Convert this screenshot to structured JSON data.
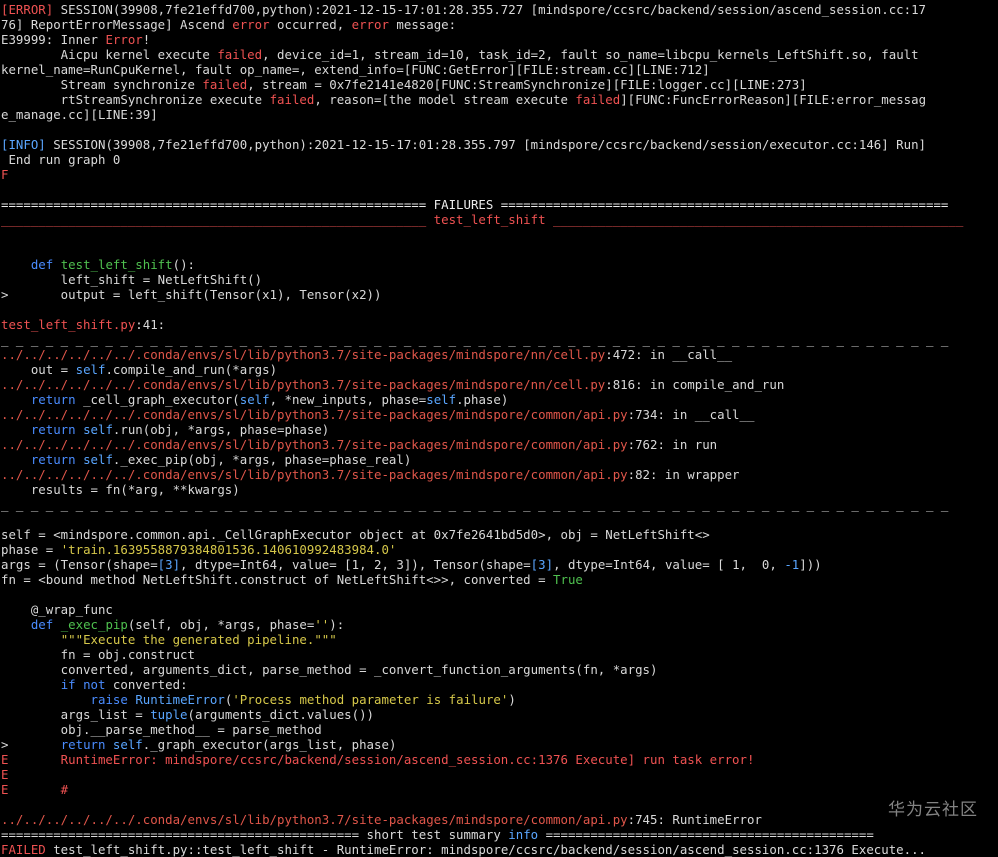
{
  "terminal": {
    "lines": [
      {
        "segs": [
          {
            "t": "[ERROR]",
            "c": "red"
          },
          {
            "t": " SESSION(39908,7fe21effd700,python):2021-12-15-17:01:28.355.727 [mindspore/ccsrc/backend/session/ascend_session.cc:17"
          }
        ]
      },
      {
        "segs": [
          {
            "t": "76] ReportErrorMessage] Ascend "
          },
          {
            "t": "error",
            "c": "red"
          },
          {
            "t": " occurred, "
          },
          {
            "t": "error",
            "c": "red"
          },
          {
            "t": " message:"
          }
        ]
      },
      {
        "segs": [
          {
            "t": "E39999: Inner "
          },
          {
            "t": "Error",
            "c": "red"
          },
          {
            "t": "!"
          }
        ]
      },
      {
        "segs": [
          {
            "t": "        Aicpu kernel execute "
          },
          {
            "t": "failed",
            "c": "red"
          },
          {
            "t": ", device_id=1, stream_id=10, task_id=2, fault so_name=libcpu_kernels_LeftShift.so, fault"
          }
        ]
      },
      {
        "segs": [
          {
            "t": "kernel_name=RunCpuKernel, fault op_name=, extend_info=[FUNC:GetError][FILE:stream.cc][LINE:712]"
          }
        ]
      },
      {
        "segs": [
          {
            "t": "        Stream synchronize "
          },
          {
            "t": "failed",
            "c": "red"
          },
          {
            "t": ", stream = 0x7fe2141e4820[FUNC:StreamSynchronize][FILE:logger.cc][LINE:273]"
          }
        ]
      },
      {
        "segs": [
          {
            "t": "        rtStreamSynchronize execute "
          },
          {
            "t": "failed",
            "c": "red"
          },
          {
            "t": ", reason=[the model stream execute "
          },
          {
            "t": "failed",
            "c": "red"
          },
          {
            "t": "][FUNC:FuncErrorReason][FILE:error_messag"
          }
        ]
      },
      {
        "segs": [
          {
            "t": "e_manage.cc][LINE:39]"
          }
        ]
      },
      {
        "segs": [
          {
            "t": ""
          }
        ]
      },
      {
        "segs": [
          {
            "t": "[INFO]",
            "c": "cyan"
          },
          {
            "t": " SESSION(39908,7fe21effd700,python):2021-12-15-17:01:28.355.797 [mindspore/ccsrc/backend/session/executor.cc:146] Run]"
          }
        ]
      },
      {
        "segs": [
          {
            "t": " End run graph 0"
          }
        ]
      },
      {
        "segs": [
          {
            "t": "F",
            "c": "red"
          }
        ]
      },
      {
        "segs": [
          {
            "t": ""
          }
        ]
      },
      {
        "segs": [
          {
            "t": "========================================================= FAILURES ============================================================",
            "c": "white"
          }
        ]
      },
      {
        "segs": [
          {
            "t": "_________________________________________________________ test_left_shift _______________________________________________________",
            "c": "red"
          }
        ]
      },
      {
        "segs": [
          {
            "t": ""
          }
        ]
      },
      {
        "segs": [
          {
            "t": ""
          }
        ]
      },
      {
        "segs": [
          {
            "t": "    "
          },
          {
            "t": "def",
            "c": "blue"
          },
          {
            "t": " "
          },
          {
            "t": "test_left_shift",
            "c": "green"
          },
          {
            "t": "():"
          }
        ]
      },
      {
        "segs": [
          {
            "t": "        left_shift = NetLeftShift()"
          }
        ]
      },
      {
        "segs": [
          {
            "t": ">       output = left_shift(Tensor(x1), Tensor(x2))"
          }
        ]
      },
      {
        "segs": [
          {
            "t": ""
          }
        ]
      },
      {
        "segs": [
          {
            "t": "test_left_shift.py",
            "c": "red"
          },
          {
            "t": ":41:"
          }
        ]
      },
      {
        "segs": [
          {
            "t": "_ _ _ _ _ _ _ _ _ _ _ _ _ _ _ _ _ _ _ _ _ _ _ _ _ _ _ _ _ _ _ _ _ _ _ _ _ _ _ _ _ _ _ _ _ _ _ _ _ _ _ _ _ _ _ _ _ _ _ _ _ _ _ _"
          }
        ]
      },
      {
        "segs": [
          {
            "t": "../../../../../../.conda/envs/sl/lib/python3.7/site-packages/mindspore/nn/cell.py",
            "c": "brick"
          },
          {
            "t": ":472: in __call__"
          }
        ]
      },
      {
        "segs": [
          {
            "t": "    out = "
          },
          {
            "t": "self",
            "c": "cyan"
          },
          {
            "t": ".compile_and_run(*args)"
          }
        ]
      },
      {
        "segs": [
          {
            "t": "../../../../../../.conda/envs/sl/lib/python3.7/site-packages/mindspore/nn/cell.py",
            "c": "brick"
          },
          {
            "t": ":816: in compile_and_run"
          }
        ]
      },
      {
        "segs": [
          {
            "t": "    "
          },
          {
            "t": "return",
            "c": "blue"
          },
          {
            "t": " _cell_graph_executor("
          },
          {
            "t": "self",
            "c": "cyan"
          },
          {
            "t": ", *new_inputs, phase="
          },
          {
            "t": "self",
            "c": "cyan"
          },
          {
            "t": ".phase)"
          }
        ]
      },
      {
        "segs": [
          {
            "t": "../../../../../../.conda/envs/sl/lib/python3.7/site-packages/mindspore/common/api.py",
            "c": "brick"
          },
          {
            "t": ":734: in __call__"
          }
        ]
      },
      {
        "segs": [
          {
            "t": "    "
          },
          {
            "t": "return",
            "c": "blue"
          },
          {
            "t": " "
          },
          {
            "t": "self",
            "c": "cyan"
          },
          {
            "t": ".run(obj, *args, phase=phase)"
          }
        ]
      },
      {
        "segs": [
          {
            "t": "../../../../../../.conda/envs/sl/lib/python3.7/site-packages/mindspore/common/api.py",
            "c": "brick"
          },
          {
            "t": ":762: in run"
          }
        ]
      },
      {
        "segs": [
          {
            "t": "    "
          },
          {
            "t": "return",
            "c": "blue"
          },
          {
            "t": " "
          },
          {
            "t": "self",
            "c": "cyan"
          },
          {
            "t": "._exec_pip(obj, *args, phase=phase_real)"
          }
        ]
      },
      {
        "segs": [
          {
            "t": "../../../../../../.conda/envs/sl/lib/python3.7/site-packages/mindspore/common/api.py",
            "c": "brick"
          },
          {
            "t": ":82: in wrapper"
          }
        ]
      },
      {
        "segs": [
          {
            "t": "    results = fn(*arg, **kwargs)"
          }
        ]
      },
      {
        "segs": [
          {
            "t": "_ _ _ _ _ _ _ _ _ _ _ _ _ _ _ _ _ _ _ _ _ _ _ _ _ _ _ _ _ _ _ _ _ _ _ _ _ _ _ _ _ _ _ _ _ _ _ _ _ _ _ _ _ _ _ _ _ _ _ _ _ _ _ _"
          }
        ]
      },
      {
        "segs": [
          {
            "t": ""
          }
        ]
      },
      {
        "segs": [
          {
            "t": "self = <mindspore.common.api._CellGraphExecutor object at 0x7fe2641bd5d0>, obj = NetLeftShift<>"
          }
        ]
      },
      {
        "segs": [
          {
            "t": "phase = "
          },
          {
            "t": "'train.1639558879384801536.140610992483984.0'",
            "c": "yellow"
          }
        ]
      },
      {
        "segs": [
          {
            "t": "args = (Tensor(shape="
          },
          {
            "t": "[3]",
            "c": "cyan"
          },
          {
            "t": ", dtype=Int64, value= [1, 2, 3]), Tensor(shape="
          },
          {
            "t": "[3]",
            "c": "cyan"
          },
          {
            "t": ", dtype=Int64, value= [ 1,  0, "
          },
          {
            "t": "-1",
            "c": "cyan"
          },
          {
            "t": "]))"
          }
        ]
      },
      {
        "segs": [
          {
            "t": "fn = <bound method NetLeftShift.construct of NetLeftShift<>>, converted = "
          },
          {
            "t": "True",
            "c": "green"
          }
        ]
      },
      {
        "segs": [
          {
            "t": ""
          }
        ]
      },
      {
        "segs": [
          {
            "t": "    @_wrap_func"
          }
        ]
      },
      {
        "segs": [
          {
            "t": "    "
          },
          {
            "t": "def",
            "c": "blue"
          },
          {
            "t": " "
          },
          {
            "t": "_exec_pip",
            "c": "green"
          },
          {
            "t": "(self, obj, *args, phase="
          },
          {
            "t": "''",
            "c": "yellow"
          },
          {
            "t": "):"
          }
        ]
      },
      {
        "segs": [
          {
            "t": "        "
          },
          {
            "t": "\"\"\"Execute the generated pipeline.\"\"\"",
            "c": "yellow"
          }
        ]
      },
      {
        "segs": [
          {
            "t": "        fn = obj.construct"
          }
        ]
      },
      {
        "segs": [
          {
            "t": "        converted, arguments_dict, parse_method = _convert_function_arguments(fn, *args)"
          }
        ]
      },
      {
        "segs": [
          {
            "t": "        "
          },
          {
            "t": "if",
            "c": "blue"
          },
          {
            "t": " "
          },
          {
            "t": "not",
            "c": "blue"
          },
          {
            "t": " converted:"
          }
        ]
      },
      {
        "segs": [
          {
            "t": "            "
          },
          {
            "t": "raise",
            "c": "blue"
          },
          {
            "t": " "
          },
          {
            "t": "RuntimeError",
            "c": "cyan"
          },
          {
            "t": "("
          },
          {
            "t": "'Process method parameter is failure'",
            "c": "yellow"
          },
          {
            "t": ")"
          }
        ]
      },
      {
        "segs": [
          {
            "t": "        args_list = "
          },
          {
            "t": "tuple",
            "c": "cyan"
          },
          {
            "t": "(arguments_dict.values())"
          }
        ]
      },
      {
        "segs": [
          {
            "t": "        obj.__parse_method__ = parse_method"
          }
        ]
      },
      {
        "segs": [
          {
            "t": ">       "
          },
          {
            "t": "return",
            "c": "blue"
          },
          {
            "t": " "
          },
          {
            "t": "self",
            "c": "cyan"
          },
          {
            "t": "._graph_executor(args_list, phase)"
          }
        ]
      },
      {
        "segs": [
          {
            "t": "E       RuntimeError: mindspore/ccsrc/backend/session/ascend_session.cc:1376 Execute] run task error!",
            "c": "red"
          }
        ]
      },
      {
        "segs": [
          {
            "t": "E",
            "c": "red"
          }
        ]
      },
      {
        "segs": [
          {
            "t": "E       #",
            "c": "red"
          }
        ]
      },
      {
        "segs": [
          {
            "t": ""
          }
        ]
      },
      {
        "segs": [
          {
            "t": "../../../../../../.conda/envs/sl/lib/python3.7/site-packages/mindspore/common/api.py",
            "c": "brick"
          },
          {
            "t": ":745: RuntimeError"
          }
        ]
      },
      {
        "segs": [
          {
            "t": "================================================ short test summary "
          },
          {
            "t": "info",
            "c": "cyan"
          },
          {
            "t": " ============================================"
          }
        ]
      },
      {
        "segs": [
          {
            "t": "FAILED",
            "c": "red"
          },
          {
            "t": " test_left_shift.py::test_left_shift - RuntimeError: mindspore/ccsrc/backend/session/ascend_session.cc:1376 Execute..."
          }
        ]
      },
      {
        "segs": [
          {
            "t": "=================================================== 1 failed in 20.36s ===================================================",
            "c": "red"
          }
        ]
      }
    ]
  },
  "watermark": "华为云社区"
}
